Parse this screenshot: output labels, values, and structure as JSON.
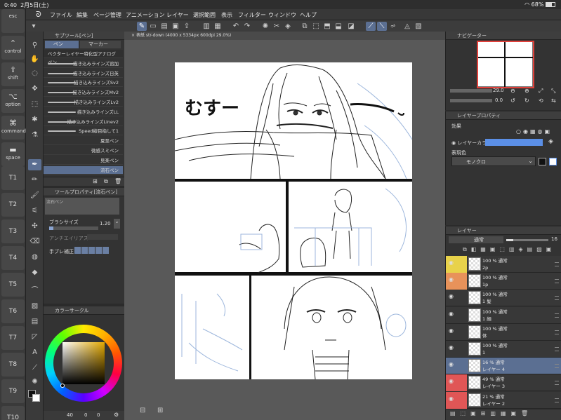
{
  "status": {
    "time": "0:40",
    "date": "2月5日(土)",
    "battery": "68%"
  },
  "edge_keys": [
    {
      "label": "esc",
      "icon": ""
    },
    {
      "label": "control",
      "icon": "⌃"
    },
    {
      "label": "shift",
      "icon": "⇧"
    },
    {
      "label": "option",
      "icon": "⌥"
    },
    {
      "label": "command",
      "icon": "⌘"
    },
    {
      "label": "space",
      "icon": "▬"
    },
    {
      "label": "T1"
    },
    {
      "label": "T2"
    },
    {
      "label": "T3"
    },
    {
      "label": "T4"
    },
    {
      "label": "T5"
    },
    {
      "label": "T6"
    },
    {
      "label": "T7"
    },
    {
      "label": "T8"
    },
    {
      "label": "T9"
    },
    {
      "label": "T10"
    }
  ],
  "menu": [
    "ファイル",
    "編集",
    "ページ管理",
    "アニメーション",
    "レイヤー",
    "選択範囲",
    "表示",
    "フィルター",
    "ウィンドウ",
    "ヘルプ"
  ],
  "subtool": {
    "title": "サブツール[ペン]",
    "tabs": [
      "ペン",
      "マーカー"
    ],
    "brushes": [
      "ベクターレイヤー特化型アナログペン",
      "描き込みラインズ追加",
      "描き込みラインズ日英",
      "描き込みラインズSv2",
      "描き込みラインズMv2",
      "描き込みラインズLv2",
      "描き込みラインズLL",
      "描き込みラインズLinev2",
      "Speed線目指して1",
      "夏至ペン",
      "微感スミペン",
      "見楽ペン",
      "流石ペン"
    ]
  },
  "toolprop": {
    "title": "ツールプロパティ[流石ペン]",
    "brush_name": "流石ペン",
    "brush_size_label": "ブラシサイズ",
    "brush_size_value": "1.20",
    "antialias_label": "アンチエイリアス",
    "stabilize_label": "手ブレ補正"
  },
  "colorpal": {
    "title": "カラーサークル",
    "footer_value": "40",
    "footer_a": "0",
    "footer_b": "0"
  },
  "document": {
    "tab_title": "表紙 str-down (4000 x 5334px 600dpi 29.0%)"
  },
  "manga": {
    "speech": "むすー"
  },
  "navigator": {
    "title": "ナビゲーター",
    "zoom": "29.0",
    "angle": "0.0"
  },
  "layerprop": {
    "title": "レイヤープロパティ",
    "effect_label": "効果",
    "layer_color_label": "レイヤーカラー",
    "expression_label": "表現色",
    "expression_value": "モノクロ"
  },
  "layers": {
    "title": "レイヤー",
    "blend_mode": "通常",
    "opacity": "16",
    "items": [
      {
        "opacity": "100 %",
        "mode": "通常",
        "name": "2p",
        "color": "yellow"
      },
      {
        "opacity": "100 %",
        "mode": "通常",
        "name": "1p",
        "color": "orange"
      },
      {
        "opacity": "100 %",
        "mode": "通常",
        "name": "1 髪",
        "color": ""
      },
      {
        "opacity": "100 %",
        "mode": "通常",
        "name": "1 顔",
        "color": ""
      },
      {
        "opacity": "100 %",
        "mode": "通常",
        "name": "体",
        "color": ""
      },
      {
        "opacity": "100 %",
        "mode": "通常",
        "name": "1",
        "color": ""
      },
      {
        "opacity": "16 %",
        "mode": "通常",
        "name": "レイヤー 4",
        "color": "",
        "selected": true
      },
      {
        "opacity": "49 %",
        "mode": "通常",
        "name": "レイヤー 3",
        "color": "red"
      },
      {
        "opacity": "21 %",
        "mode": "通常",
        "name": "レイヤー 2",
        "color": "red"
      }
    ]
  },
  "colors": {
    "accent": "#5b6f92",
    "layer_color": "#5b8fe6",
    "yellow": "#e8d24a",
    "orange": "#e8925a",
    "red": "#e05656",
    "sketch_blue": "#9cb6dc"
  }
}
